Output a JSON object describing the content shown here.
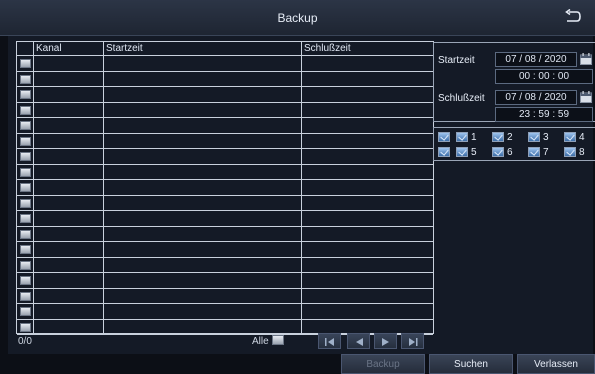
{
  "window": {
    "title": "Backup"
  },
  "table": {
    "columns": [
      "Kanal",
      "Startzeit",
      "Schlußzeit"
    ],
    "row_count": 18,
    "result_count": "0/0",
    "select_all_label": "Alle"
  },
  "time": {
    "start_label": "Startzeit",
    "start_date": "07 / 08 / 2020",
    "start_time": "00 : 00 : 00",
    "end_label": "Schlußzeit",
    "end_date": "07 / 08 / 2020",
    "end_time": "23 : 59 : 59"
  },
  "channels": [
    "1",
    "2",
    "3",
    "4",
    "5",
    "6",
    "7",
    "8"
  ],
  "buttons": {
    "backup": "Backup",
    "search": "Suchen",
    "exit": "Verlassen"
  },
  "icons": {
    "back": "return-arrow-icon",
    "calendar": "calendar-icon",
    "pager": [
      "first-page-icon",
      "prev-page-icon",
      "next-page-icon",
      "last-page-icon"
    ]
  },
  "colors": {
    "background": "#0c0f16",
    "panel": "#141a26",
    "checkbox_checked": "#3d6ea8"
  }
}
